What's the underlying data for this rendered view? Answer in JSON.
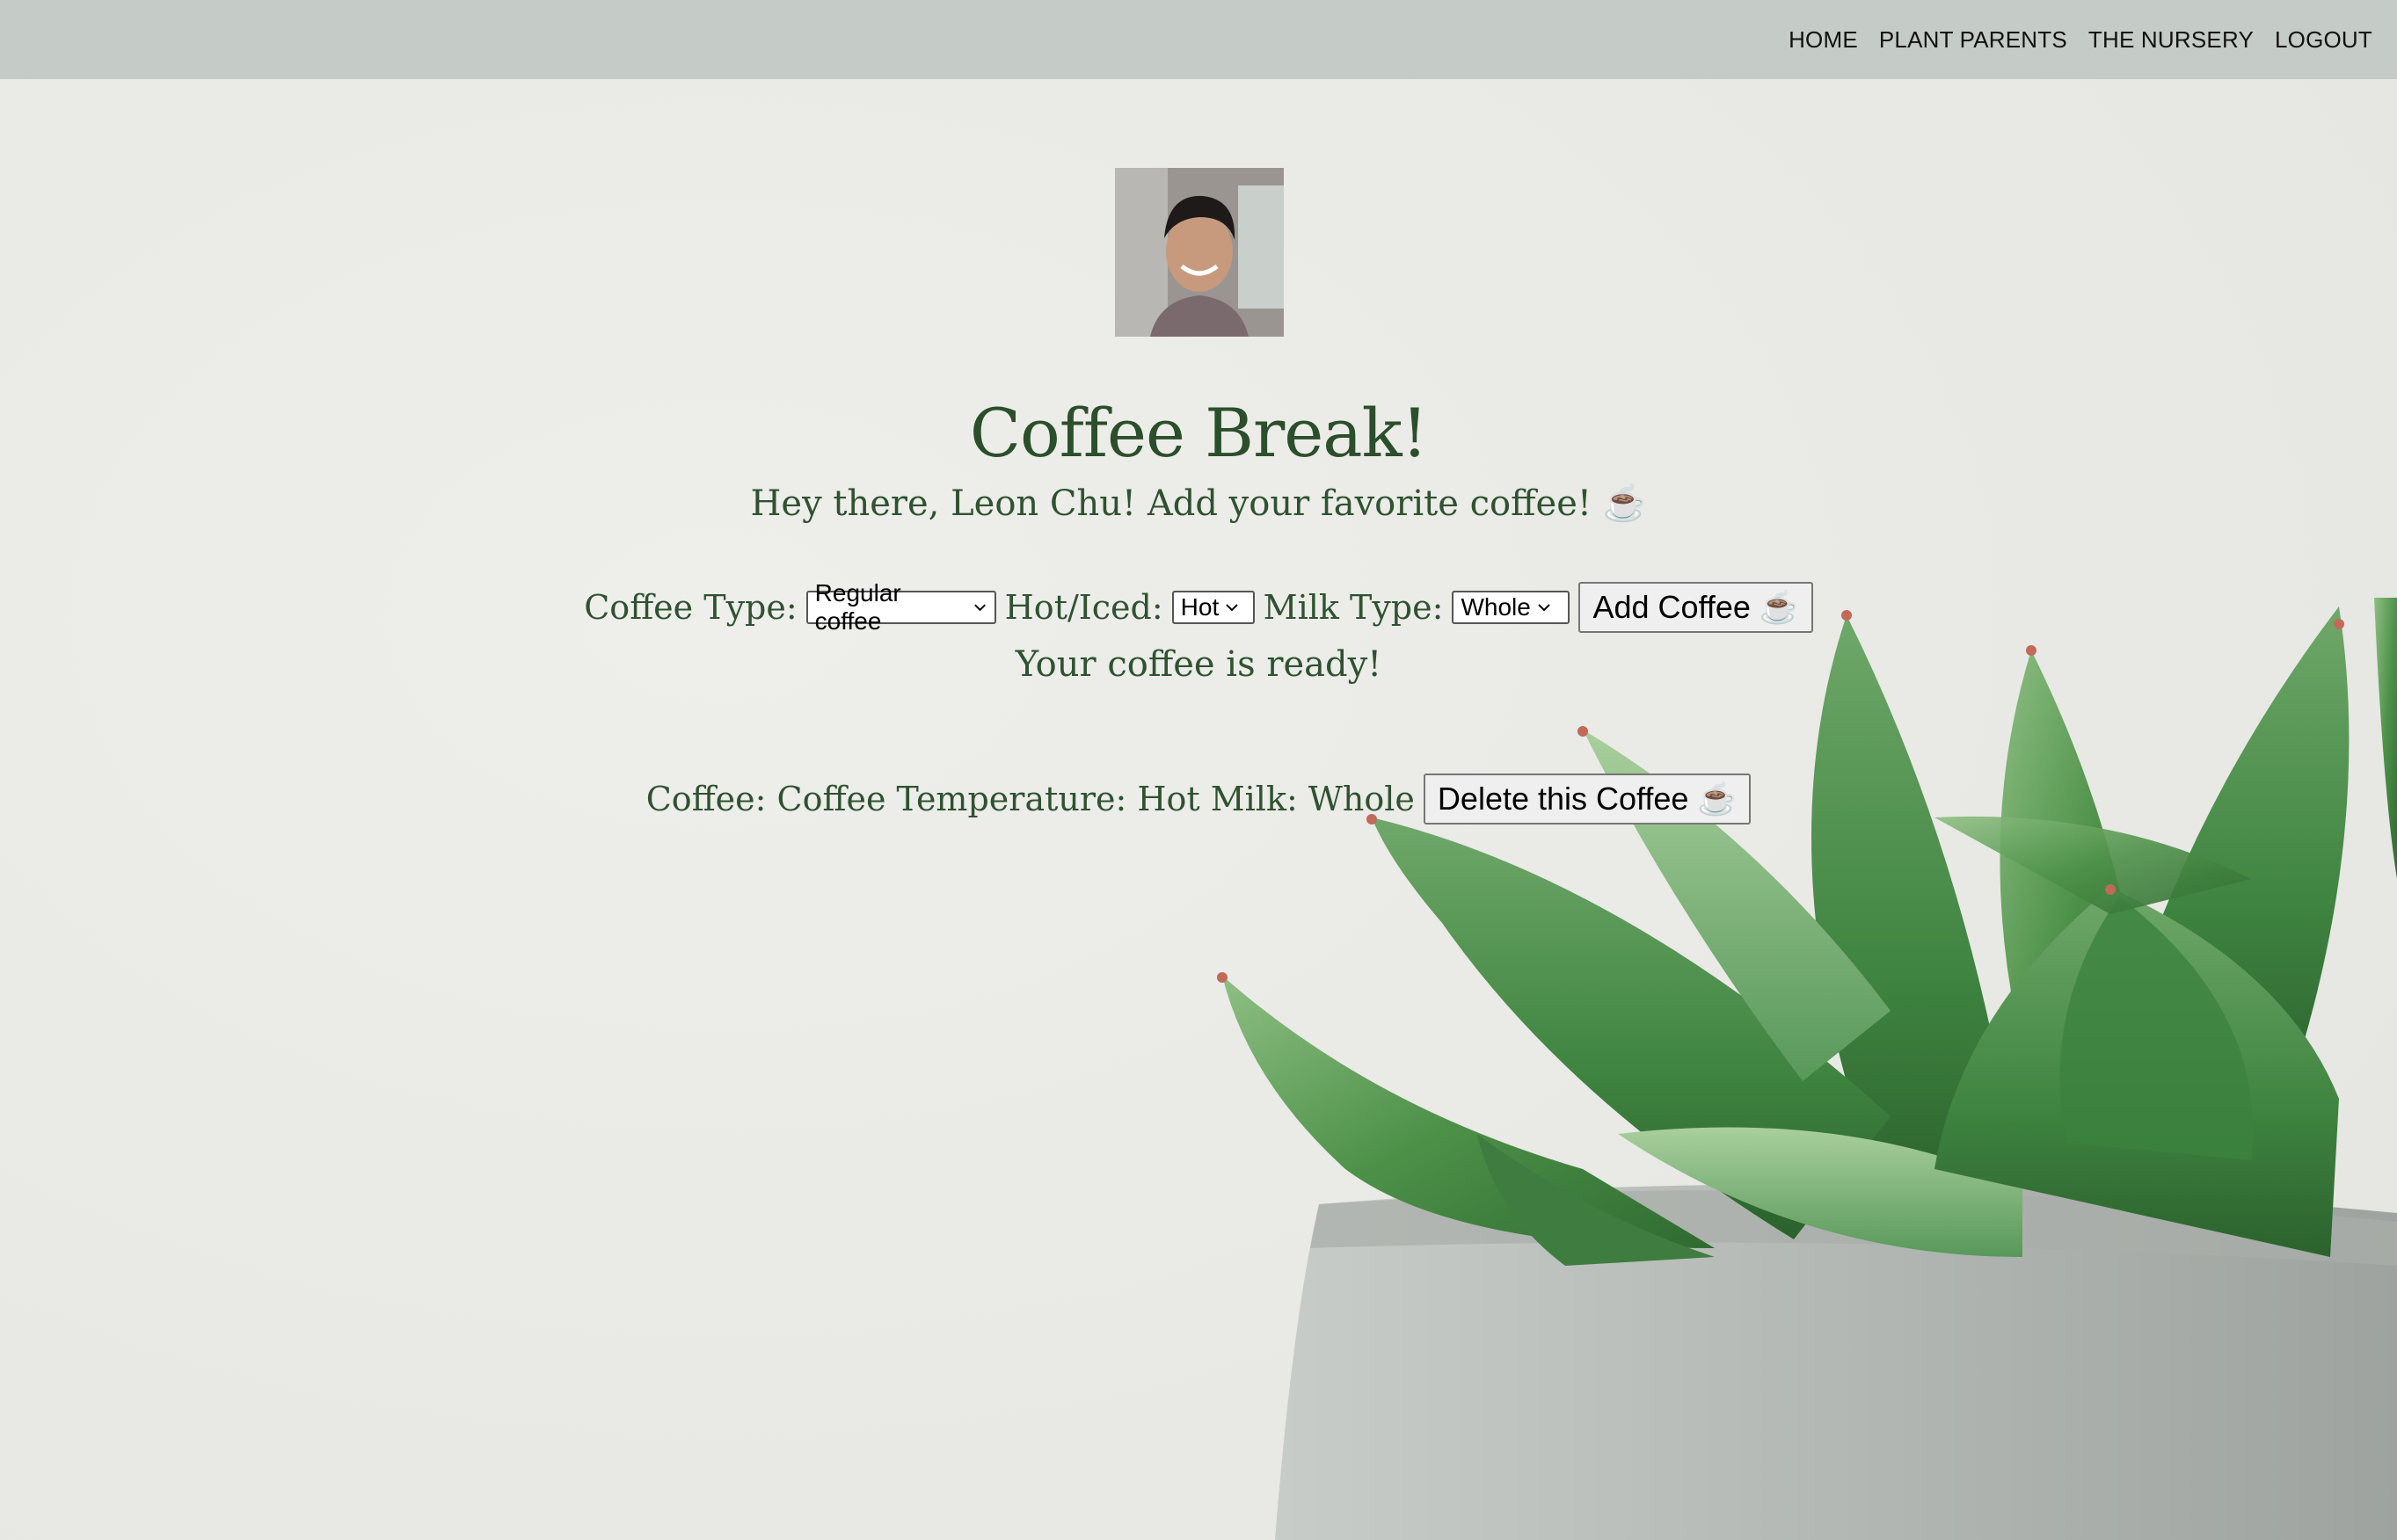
{
  "nav": {
    "items": [
      "HOME",
      "PLANT PARENTS",
      "THE NURSERY",
      "LOGOUT"
    ]
  },
  "profile": {
    "avatar_alt": "user avatar"
  },
  "page": {
    "title": "Coffee Break!",
    "subtitle": "Hey there, Leon Chu! Add your favorite coffee! ☕"
  },
  "form": {
    "coffee_type_label": "Coffee Type:",
    "coffee_type_value": "Regular coffee",
    "temp_label": "Hot/Iced:",
    "temp_value": "Hot",
    "milk_label": "Milk Type:",
    "milk_value": "Whole",
    "add_button": "Add Coffee ☕"
  },
  "status": {
    "message": "Your coffee is ready!"
  },
  "coffee_entry": {
    "text": "Coffee: Coffee Temperature: Hot Milk: Whole",
    "delete_button": "Delete this Coffee ☕"
  },
  "colors": {
    "navbar": "#c5cbc6",
    "heading_green": "#2b4e2b",
    "background": "#ebebe8"
  }
}
